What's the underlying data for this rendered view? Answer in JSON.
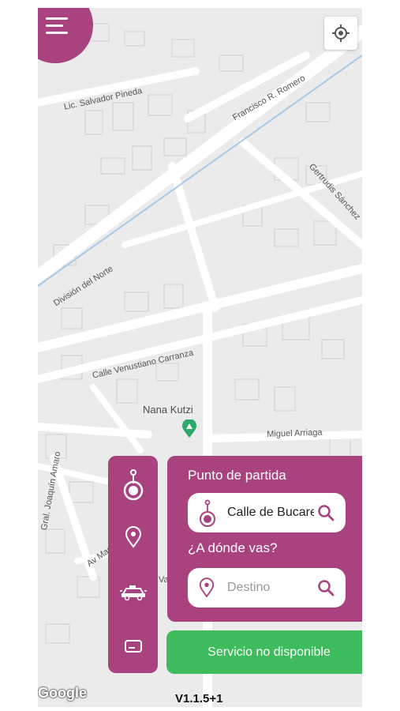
{
  "map": {
    "streets": [
      "Lic. Salvador Pineda",
      "Francisco R. Romero",
      "Gertrudis Sánchez",
      "División del Norte",
      "Calle Venustiano Carranza",
      "Miguel Arriaga",
      "Gral. Joaquín Amaro",
      "Av Mar",
      "Vall"
    ],
    "place": "Nana Kutzi",
    "attribution": "Google"
  },
  "icons": {
    "menu": "hamburger-menu-icon",
    "locate": "crosshair-locate-icon",
    "origin": "origin-pin-icon",
    "destination": "location-pin-icon",
    "car": "taxi-car-icon",
    "card": "credit-card-icon",
    "search": "search-icon"
  },
  "form": {
    "origin_label": "Punto de partida",
    "origin_value": "Calle de Bucareli",
    "destination_label": "¿A dónde vas?",
    "destination_placeholder": "Destino"
  },
  "service_button": "Servicio no disponible",
  "version": "V1.1.5+1",
  "colors": {
    "primary": "#a8437f",
    "success": "#3ebb5c",
    "map_bg": "#ececec"
  }
}
